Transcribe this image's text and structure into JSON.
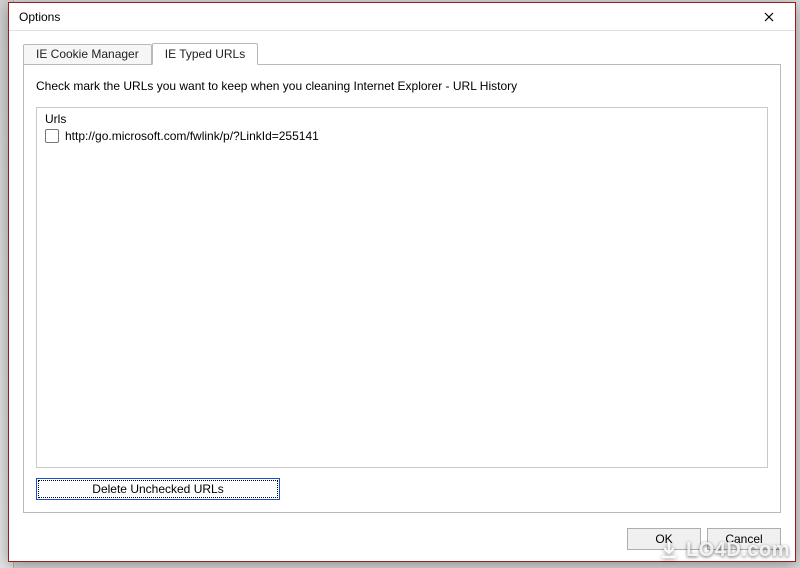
{
  "window": {
    "title": "Options"
  },
  "tabs": [
    {
      "label": "IE Cookie Manager",
      "active": false
    },
    {
      "label": "IE Typed URLs",
      "active": true
    }
  ],
  "panel": {
    "instruction": "Check mark the URLs you want to keep when you cleaning Internet Explorer - URL History",
    "group_title": "Urls",
    "items": [
      {
        "checked": false,
        "url": "http://go.microsoft.com/fwlink/p/?LinkId=255141"
      }
    ],
    "delete_button": "Delete Unchecked URLs"
  },
  "buttons": {
    "ok": "OK",
    "cancel": "Cancel"
  },
  "watermark": "LO4D.com"
}
